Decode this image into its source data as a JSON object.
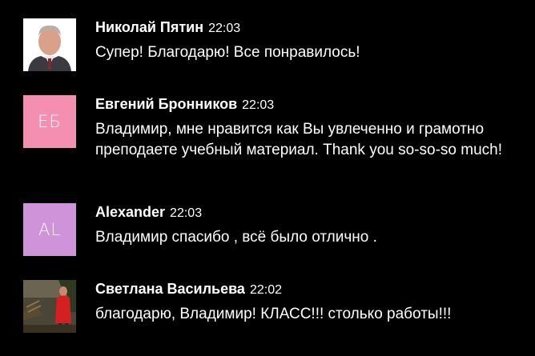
{
  "messages": [
    {
      "author": "Николай Пятин",
      "time": "22:03",
      "text": "Супер! Благодарю! Все понравилось!",
      "avatar": {
        "type": "photo",
        "icon": "user-photo-icon"
      }
    },
    {
      "author": "Евгений Бронников",
      "time": "22:03",
      "text": "Владимир, мне нравится как Вы увлеченно и грамотно преподаете учебный материал. Thank you so-so-so much!",
      "avatar": {
        "type": "initials",
        "initials": "ЕБ",
        "color": "#f48fb1"
      }
    },
    {
      "author": "Alexander",
      "time": "22:03",
      "text": "Владимир спасибо , всё было отлично .",
      "avatar": {
        "type": "initials",
        "initials": "AL",
        "color": "#ce93d8"
      }
    },
    {
      "author": "Светлана Васильева",
      "time": "22:02",
      "text": "благодарю, Владимир! КЛАСС!!! столько работы!!!",
      "avatar": {
        "type": "photo",
        "icon": "user-photo-icon"
      }
    }
  ]
}
